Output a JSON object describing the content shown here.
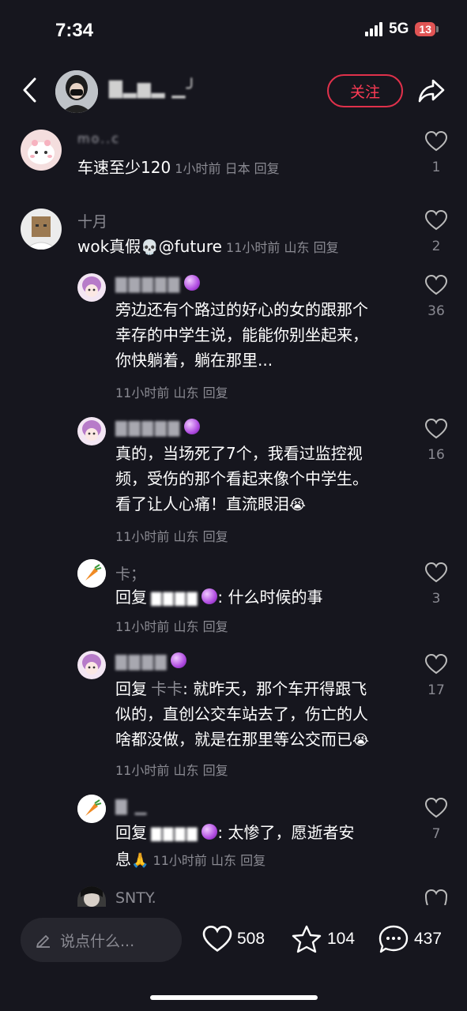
{
  "status_bar": {
    "time": "7:34",
    "network": "5G",
    "battery": "13"
  },
  "header": {
    "username": "▇▂▆▂ ▁╯",
    "follow_label": "关注"
  },
  "comments": [
    {
      "user": "mo..c",
      "text": "车速至少120",
      "time": "1小时前",
      "location": "日本",
      "reply": "回复",
      "likes": "1"
    },
    {
      "user": "十月",
      "text": "wok真假",
      "mention": "@future",
      "time": "11小时前",
      "location": "山东",
      "reply": "回复",
      "likes": "2"
    }
  ],
  "replies": [
    {
      "user": "▇▇▇▇▇",
      "lines": [
        "旁边还有个路过的好心的女的跟那个",
        "幸存的中学生说，能能你别坐起来，",
        "你快躺着，躺在那里..."
      ],
      "time": "11小时前",
      "location": "山东",
      "reply": "回复",
      "likes": "36"
    },
    {
      "user": "▇▇▇▇▇",
      "lines": [
        "真的，当场死了7个，我看过监控视",
        "频，受伤的那个看起来像个中学生。",
        "看了让人心痛！直流眼泪"
      ],
      "time": "11小时前",
      "location": "山东",
      "reply": "回复",
      "likes": "16"
    },
    {
      "user": "卡；",
      "prefix": "回复",
      "target": "▇▇▇▇",
      "text": ": 什么时候的事",
      "time": "11小时前",
      "location": "山东",
      "reply": "回复",
      "likes": "3"
    },
    {
      "user": "▇▇▇▇",
      "prefix": "回复",
      "target": "卡卡",
      "lines": [
        ": 就昨天，那个车开得跟飞",
        "似的，直创公交车站去了，伤亡的人",
        "啥都没做，就是在那里等公交而已"
      ],
      "time": "11小时前",
      "location": "山东",
      "reply": "回复",
      "likes": "17"
    },
    {
      "user": "▇ ▁",
      "prefix": "回复",
      "target": "▇▇▇▇",
      "lines": [
        ": 太惨了，愿逝者安",
        "息"
      ],
      "time": "11小时前",
      "location": "山东",
      "reply": "回复",
      "likes": "7"
    }
  ],
  "partial_comment": {
    "user": "SNTY."
  },
  "bottom_bar": {
    "input_placeholder": "说点什么...",
    "likes": "508",
    "favorites": "104",
    "comments": "437"
  },
  "colors": {
    "background": "#16161e",
    "accent": "#ff3b55",
    "muted": "#8a8a92"
  }
}
